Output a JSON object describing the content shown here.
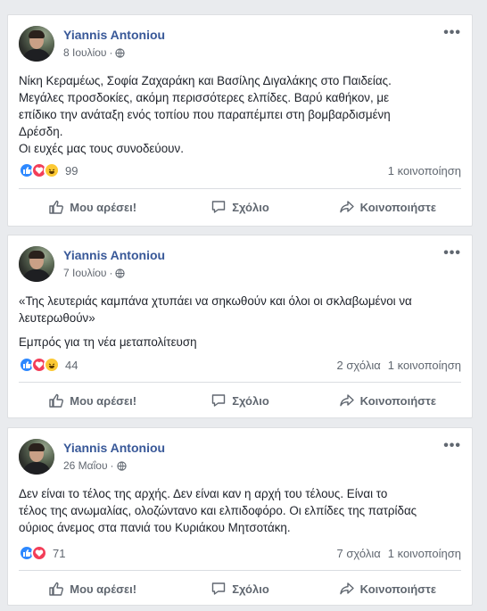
{
  "posts": [
    {
      "author": "Yiannis Antoniou",
      "date": "8 Ιουλίου",
      "text": [
        "Νίκη Κεραμέως, Σοφία Ζαχαράκη και Βασίλης Διγαλάκης στο Παιδείας.",
        "Μεγάλες προσδοκίες, ακόμη περισσότερες ελπίδες. Βαρύ καθήκον, με",
        "επίδικο την ανάταξη ενός τοπίου που παραπέμπει στη βομβαρδισμένη",
        "Δρέσδη.",
        "Οι ευχές μας τους συνοδεύουν."
      ],
      "reaction_count": "99",
      "comments": "",
      "shares": "1 κοινοποίηση",
      "reactions": [
        "like",
        "love",
        "haha"
      ]
    },
    {
      "author": "Yiannis Antoniou",
      "date": "7 Ιουλίου",
      "text": [
        "«Της λευτεριάς καμπάνα χτυπάει να σηκωθούν και όλοι οι σκλαβωμένοι να",
        "λευτερωθούν»",
        "",
        "Εμπρός για τη νέα μεταπολίτευση"
      ],
      "reaction_count": "44",
      "comments": "2 σχόλια",
      "shares": "1 κοινοποίηση",
      "reactions": [
        "like",
        "love",
        "haha"
      ]
    },
    {
      "author": "Yiannis Antoniou",
      "date": "26 Μαΐου",
      "text": [
        "Δεν είναι το τέλος της αρχής. Δεν είναι καν η αρχή του τέλους. Είναι το",
        "τέλος της ανωμαλίας, ολοζώντανο και ελπιδοφόρο. Οι ελπίδες της πατρίδας",
        "ούριος άνεμος στα πανιά του Κυριάκου Μητσοτάκη."
      ],
      "reaction_count": "71",
      "comments": "7 σχόλια",
      "shares": "1 κοινοποίηση",
      "reactions": [
        "like",
        "love"
      ]
    }
  ],
  "actions": {
    "like": "Μου αρέσει!",
    "comment": "Σχόλιο",
    "share": "Κοινοποιήστε"
  },
  "icons": [
    "globe-icon",
    "more-icon",
    "like-reaction-icon",
    "love-reaction-icon",
    "haha-reaction-icon",
    "thumbs-up-icon",
    "comment-icon",
    "share-icon"
  ],
  "colors": {
    "author": "#385898",
    "like": "#2d88ff",
    "love": "#f33e58",
    "haha": "#fcc934",
    "background": "#e9ebee"
  }
}
